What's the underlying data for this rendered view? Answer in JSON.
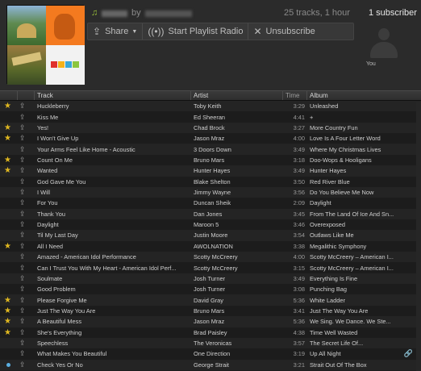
{
  "header": {
    "by_label": "by",
    "track_meta": "25 tracks, 1 hour",
    "subscriber_label": "1 subscriber",
    "you_label": "You"
  },
  "actions": {
    "share": "Share",
    "radio": "Start Playlist Radio",
    "unsubscribe": "Unsubscribe"
  },
  "columns": {
    "track": "Track",
    "artist": "Artist",
    "time": "Time",
    "album": "Album"
  },
  "colors": {
    "star": "#e0b820",
    "playing": "#5aaee0",
    "accent_note": "#9bc23a"
  },
  "tracks": [
    {
      "starred": true,
      "track": "Huckleberry",
      "artist": "Toby Keith",
      "time": "3:29",
      "album": "Unleashed"
    },
    {
      "starred": false,
      "track": "Kiss Me",
      "artist": "Ed Sheeran",
      "time": "4:41",
      "album": "+"
    },
    {
      "starred": true,
      "track": "Yes!",
      "artist": "Chad Brock",
      "time": "3:27",
      "album": "More Country Fun"
    },
    {
      "starred": true,
      "track": "I Won't Give Up",
      "artist": "Jason Mraz",
      "time": "4:00",
      "album": "Love Is A Four Letter Word"
    },
    {
      "starred": false,
      "track": "Your Arms Feel Like Home - Acoustic",
      "artist": "3 Doors Down",
      "time": "3:49",
      "album": "Where My Christmas Lives"
    },
    {
      "starred": true,
      "track": "Count On Me",
      "artist": "Bruno Mars",
      "time": "3:18",
      "album": "Doo-Wops & Hooligans"
    },
    {
      "starred": true,
      "track": "Wanted",
      "artist": "Hunter Hayes",
      "time": "3:49",
      "album": "Hunter Hayes"
    },
    {
      "starred": false,
      "track": "God Gave Me You",
      "artist": "Blake Shelton",
      "time": "3:50",
      "album": "Red River Blue"
    },
    {
      "starred": false,
      "track": "I Will",
      "artist": "Jimmy Wayne",
      "time": "3:56",
      "album": "Do You Believe Me Now"
    },
    {
      "starred": false,
      "track": "For You",
      "artist": "Duncan Sheik",
      "time": "2:09",
      "album": "Daylight"
    },
    {
      "starred": false,
      "track": "Thank You",
      "artist": "Dan Jones",
      "time": "3:45",
      "album": "From The Land Of Ice And Sn..."
    },
    {
      "starred": false,
      "track": "Daylight",
      "artist": "Maroon 5",
      "time": "3:46",
      "album": "Overexposed"
    },
    {
      "starred": false,
      "track": "Til My Last Day",
      "artist": "Justin Moore",
      "time": "3:54",
      "album": "Outlaws Like Me"
    },
    {
      "starred": true,
      "track": "All I Need",
      "artist": "AWOLNATION",
      "time": "3:38",
      "album": "Megalithic Symphony"
    },
    {
      "starred": false,
      "track": "Amazed - American Idol Performance",
      "artist": "Scotty McCreery",
      "time": "4:00",
      "album": "Scotty McCreery – American I..."
    },
    {
      "starred": false,
      "track": "Can I Trust You With My Heart - American Idol Perf...",
      "artist": "Scotty McCreery",
      "time": "3:15",
      "album": "Scotty McCreery – American I..."
    },
    {
      "starred": false,
      "track": "Soulmate",
      "artist": "Josh Turner",
      "time": "3:49",
      "album": "Everything Is Fine"
    },
    {
      "starred": false,
      "track": "Good Problem",
      "artist": "Josh Turner",
      "time": "3:08",
      "album": "Punching Bag"
    },
    {
      "starred": true,
      "track": "Please Forgive Me",
      "artist": "David Gray",
      "time": "5:36",
      "album": "White Ladder"
    },
    {
      "starred": true,
      "track": "Just The Way You Are",
      "artist": "Bruno Mars",
      "time": "3:41",
      "album": "Just The Way You Are"
    },
    {
      "starred": true,
      "track": "A Beautiful Mess",
      "artist": "Jason Mraz",
      "time": "5:36",
      "album": "We Sing.  We Dance.  We Ste..."
    },
    {
      "starred": true,
      "track": "She's Everything",
      "artist": "Brad Paisley",
      "time": "4:38",
      "album": "Time Well Wasted"
    },
    {
      "starred": false,
      "track": "Speechless",
      "artist": "The Veronicas",
      "time": "3:57",
      "album": "The Secret Life Of..."
    },
    {
      "starred": false,
      "track": "What Makes You Beautiful",
      "artist": "One Direction",
      "time": "3:19",
      "album": "Up All Night"
    },
    {
      "starred": false,
      "track": "Check Yes Or No",
      "artist": "George Strait",
      "time": "3:21",
      "album": "Strait Out Of The Box"
    }
  ]
}
